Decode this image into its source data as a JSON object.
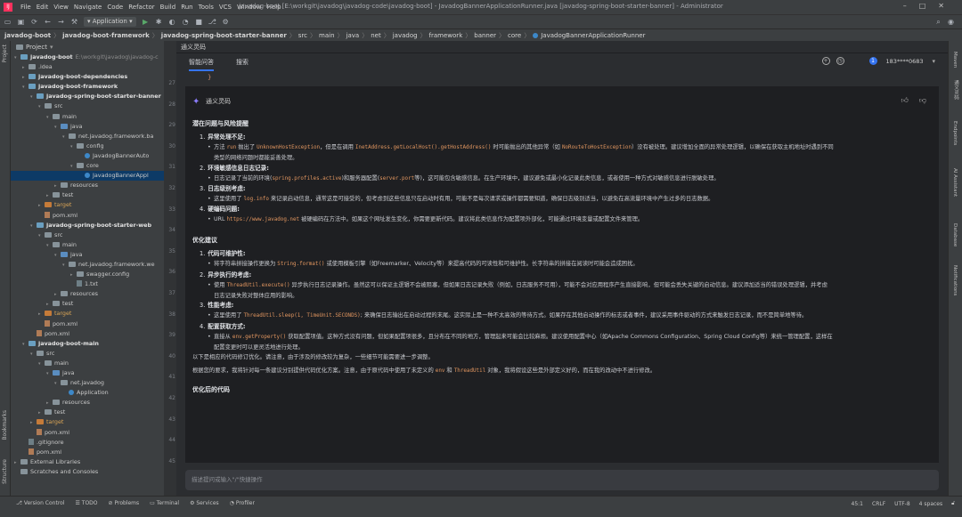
{
  "window": {
    "title": "javadog-boot [E:\\workgit\\javadog\\javadog-code\\javadog-boot] - JavadogBannerApplicationRunner.java [javadog-spring-boot-starter-banner] - Administrator",
    "menu": [
      "File",
      "Edit",
      "View",
      "Navigate",
      "Code",
      "Refactor",
      "Build",
      "Run",
      "Tools",
      "VCS",
      "Window",
      "Help"
    ],
    "run_config": "Application"
  },
  "breadcrumb": [
    "javadog-boot",
    "javadog-boot-framework",
    "javadog-spring-boot-starter-banner",
    "src",
    "main",
    "java",
    "net",
    "javadog",
    "framework",
    "banner",
    "core",
    "JavadogBannerApplicationRunner"
  ],
  "left_strip": {
    "project": "Project",
    "bookmarks": "Bookmarks",
    "structure": "Structure"
  },
  "project": {
    "header": "Project",
    "tree": [
      {
        "indent": 0,
        "arrow": "▾",
        "icon": "folder mod",
        "bold": "javadog-boot",
        "path": "E:\\workgit\\javadog\\javadog-c"
      },
      {
        "indent": 1,
        "arrow": "▸",
        "icon": "folder",
        "text": ".idea"
      },
      {
        "indent": 1,
        "arrow": "▸",
        "icon": "folder mod",
        "bold": "javadog-boot-dependencies"
      },
      {
        "indent": 1,
        "arrow": "▾",
        "icon": "folder mod",
        "bold": "javadog-boot-framework"
      },
      {
        "indent": 2,
        "arrow": "▾",
        "icon": "folder mod",
        "bold": "javadog-spring-boot-starter-banner"
      },
      {
        "indent": 3,
        "arrow": "▾",
        "icon": "folder",
        "text": "src"
      },
      {
        "indent": 4,
        "arrow": "▾",
        "icon": "folder",
        "text": "main"
      },
      {
        "indent": 5,
        "arrow": "▾",
        "icon": "folder blue",
        "text": "java"
      },
      {
        "indent": 6,
        "arrow": "▾",
        "icon": "folder",
        "text": "net.javadog.framework.ba"
      },
      {
        "indent": 7,
        "arrow": "▾",
        "icon": "folder",
        "text": "config"
      },
      {
        "indent": 8,
        "arrow": "",
        "icon": "class",
        "text": "JavadogBannerAuto"
      },
      {
        "indent": 7,
        "arrow": "▾",
        "icon": "folder",
        "text": "core"
      },
      {
        "indent": 8,
        "arrow": "",
        "icon": "class",
        "text": "JavadogBannerAppl",
        "selected": true
      },
      {
        "indent": 5,
        "arrow": "▸",
        "icon": "folder",
        "text": "resources"
      },
      {
        "indent": 4,
        "arrow": "▸",
        "icon": "folder",
        "text": "test"
      },
      {
        "indent": 3,
        "arrow": "▸",
        "icon": "folder orange",
        "text": "target",
        "orange": true
      },
      {
        "indent": 3,
        "arrow": "",
        "icon": "file m",
        "text": "pom.xml"
      },
      {
        "indent": 2,
        "arrow": "▾",
        "icon": "folder mod",
        "bold": "javadog-spring-boot-starter-web"
      },
      {
        "indent": 3,
        "arrow": "▾",
        "icon": "folder",
        "text": "src"
      },
      {
        "indent": 4,
        "arrow": "▾",
        "icon": "folder",
        "text": "main"
      },
      {
        "indent": 5,
        "arrow": "▾",
        "icon": "folder blue",
        "text": "java"
      },
      {
        "indent": 6,
        "arrow": "▾",
        "icon": "folder",
        "text": "net.javadog.framework.we"
      },
      {
        "indent": 7,
        "arrow": "▸",
        "icon": "folder",
        "text": "swagger.config"
      },
      {
        "indent": 7,
        "arrow": "",
        "icon": "file",
        "text": "1.txt"
      },
      {
        "indent": 5,
        "arrow": "▸",
        "icon": "folder",
        "text": "resources"
      },
      {
        "indent": 4,
        "arrow": "▸",
        "icon": "folder",
        "text": "test"
      },
      {
        "indent": 3,
        "arrow": "▸",
        "icon": "folder orange",
        "text": "target",
        "orange": true
      },
      {
        "indent": 3,
        "arrow": "",
        "icon": "file m",
        "text": "pom.xml"
      },
      {
        "indent": 2,
        "arrow": "",
        "icon": "file m",
        "text": "pom.xml"
      },
      {
        "indent": 1,
        "arrow": "▾",
        "icon": "folder mod",
        "bold": "javadog-boot-main"
      },
      {
        "indent": 2,
        "arrow": "▾",
        "icon": "folder",
        "text": "src"
      },
      {
        "indent": 3,
        "arrow": "▾",
        "icon": "folder",
        "text": "main"
      },
      {
        "indent": 4,
        "arrow": "▾",
        "icon": "folder blue",
        "text": "java"
      },
      {
        "indent": 5,
        "arrow": "▾",
        "icon": "folder",
        "text": "net.javadog"
      },
      {
        "indent": 6,
        "arrow": "",
        "icon": "class",
        "text": "Application"
      },
      {
        "indent": 4,
        "arrow": "▸",
        "icon": "folder",
        "text": "resources"
      },
      {
        "indent": 3,
        "arrow": "▸",
        "icon": "folder",
        "text": "test"
      },
      {
        "indent": 2,
        "arrow": "▸",
        "icon": "folder orange",
        "text": "target",
        "orange": true
      },
      {
        "indent": 2,
        "arrow": "",
        "icon": "file m",
        "text": "pom.xml"
      },
      {
        "indent": 1,
        "arrow": "",
        "icon": "file",
        "text": ".gitignore"
      },
      {
        "indent": 1,
        "arrow": "",
        "icon": "file m",
        "text": "pom.xml"
      },
      {
        "indent": 0,
        "arrow": "▸",
        "icon": "folder",
        "text": "External Libraries"
      },
      {
        "indent": 0,
        "arrow": "",
        "icon": "folder",
        "text": "Scratches and Consoles"
      }
    ]
  },
  "gutter": {
    "line_numbers": [
      "27",
      "28",
      "29",
      "30",
      "31",
      "32",
      "33",
      "34",
      "35",
      "36",
      "37",
      "38",
      "39",
      "40",
      "41",
      "42",
      "43",
      "44",
      "45"
    ]
  },
  "tongyi": {
    "panel_title": "通义灵码",
    "tabs": [
      "智能问答",
      "搜索"
    ],
    "user": "183****0683",
    "user_initial": "1",
    "code_tail": "}",
    "ai_name": "通义灵码",
    "sec1_title": "潜在问题与风险提醒",
    "sec1_items": [
      {
        "num": "1.",
        "title": "异常处理不足:"
      },
      {
        "num": "2.",
        "title": "环境敏感信息日志记录:"
      },
      {
        "num": "3.",
        "title": "日志级别考虑:"
      },
      {
        "num": "4.",
        "title": "硬编码问题:"
      }
    ],
    "b1_a": "方法 ",
    "b1_code1": "run",
    "b1_b": " 抛出了 ",
    "b1_code2": "UnknownHostException",
    "b1_c": "，但是在调用 ",
    "b1_code3": "InetAddress.getLocalHost().getHostAddress()",
    "b1_d": " 时可能抛出的其他异常（如 ",
    "b1_code4": "NoRouteToHostException",
    "b1_e": "）没有被处理。建议增加全面的异常处理逻辑，以确保在获取主机地址时遇到不同",
    "b1_f": "类型的网络问题时都能妥善处理。",
    "b2_a": "日志记录了当前的环境(",
    "b2_code1": "spring.profiles.active",
    "b2_b": ")和服务器配置(",
    "b2_code2": "server.port",
    "b2_c": "等)，这可能包含敏感信息。在生产环境中，建议避免或最小化记录此类信息，或者使用一种方式对敏感信息进行脱敏处理。",
    "b3_a": "这里使用了 ",
    "b3_code1": "log.info",
    "b3_b": " 来记录启动信息，通常这是可接受的，但考虑到这些信息只在启动时有用，可能不是每次请求或操作都需要知道，确保日志级别适当，以避免在高流量环境中产生过多的日志数据。",
    "b4_a": "URL ",
    "b4_code1": "https://www.javadog.net",
    "b4_b": " 被硬编码在方法中。如果这个网址发生变化，你需要更新代码。建议将此类信息作为配置项外部化，可能通过环境变量或配置文件来管理。",
    "sec2_title": "优化建议",
    "sec2_items": [
      {
        "num": "1.",
        "title": "代码可维护性:"
      },
      {
        "num": "2.",
        "title": "异步执行的考虑:"
      },
      {
        "num": "3.",
        "title": "性能考虑:"
      },
      {
        "num": "4.",
        "title": "配置获取方式:"
      }
    ],
    "o1_a": "将字符串拼接操作更换为 ",
    "o1_code1": "String.format()",
    "o1_b": " 或使用模板引擎（如Freemarker、Velocity等）来提高代码的可读性和可维护性。长字符串的拼接在阅读时可能会造成困扰。",
    "o2_a": "使用 ",
    "o2_code1": "ThreadUtil.execute()",
    "o2_b": " 异步执行日志记录操作。虽然这可以保证主逻辑不会被阻塞，但如果日志记录失败（例如，日志服务不可用），可能不会对应用程序产生直接影响，但可能会丢失关键的启动信息。建议添加适当的错误处理逻辑，并考虑",
    "o2_c": "日志记录失败对整体应用的影响。",
    "o3_a": "这里使用了 ",
    "o3_code1": "ThreadUtil.sleep(1, TimeUnit.SECONDS)",
    "o3_b": "; 来确保日志输出在启动过程的末尾。这实际上是一种不太高效的等待方式。如果存在其他启动操作的标志或者事件，建议采用事件驱动的方式来触发日志记录，而不是简单地等待。",
    "o4_a": "直接从 ",
    "o4_code1": "env.getProperty()",
    "o4_b": " 获取配置项值。这种方式没有问题，但如果配置项很多，且分布在不同的地方，管理起来可能会比较麻烦。建议使用配置中心（如Apache Commons Configuration、Spring Cloud Config等）来统一管理配置，这样在",
    "o4_c": "配置变更时可以更灵活地进行处理。",
    "p1": "以下是相应的代码修订优化。请注意，由于涉及的修改较为复杂，一些细节可能需要进一步调整。",
    "p2_a": "根据您的要求，我将针对每一条建议分别提供代码优化方案。注意，由于原代码中使用了未定义的 ",
    "p2_code1": "env",
    "p2_b": " 和 ",
    "p2_code2": "ThreadUtil",
    "p2_c": " 对象，我将假设这些是外部定义好的，而在我的改动中不进行修改。",
    "sec3_title": "优化后的代码",
    "input_placeholder": "描述提问或输入\"/\"快捷操作"
  },
  "right_strip": [
    "Maven",
    "通义灵码",
    "Endpoints",
    "AI Assistant",
    "Database",
    "Notifications"
  ],
  "statusbar": {
    "left": [
      "Version Control",
      "TODO",
      "Problems",
      "Terminal",
      "Services",
      "Profiler"
    ],
    "right": [
      "45:1",
      "CRLF",
      "UTF-8",
      "4 spaces"
    ]
  }
}
